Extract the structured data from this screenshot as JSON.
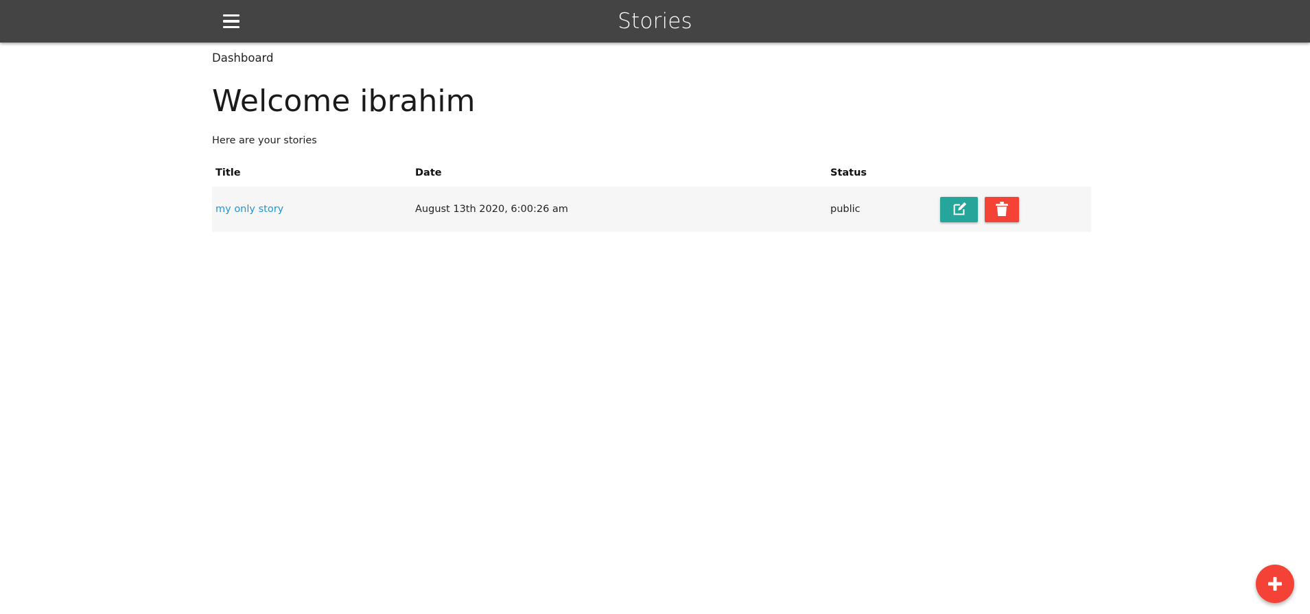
{
  "navbar": {
    "brand": "Stories",
    "menu_icon": "hamburger-menu-icon"
  },
  "breadcrumb": "Dashboard",
  "welcome": {
    "heading": "Welcome ibrahim",
    "subtext": "Here are your stories"
  },
  "table": {
    "headers": [
      "Title",
      "Date",
      "Status",
      ""
    ],
    "rows": [
      {
        "title": "my only story",
        "date": "August 13th 2020, 6:00:26 am",
        "status": "public",
        "edit_icon": "edit-icon",
        "delete_icon": "trash-icon"
      }
    ]
  },
  "fab": {
    "icon": "plus-icon"
  },
  "colors": {
    "navbar": "#444444",
    "link": "#2196d3",
    "edit": "#26a69a",
    "delete": "#f44336",
    "fab": "#f44336",
    "row_bg": "#f6f6f6"
  }
}
